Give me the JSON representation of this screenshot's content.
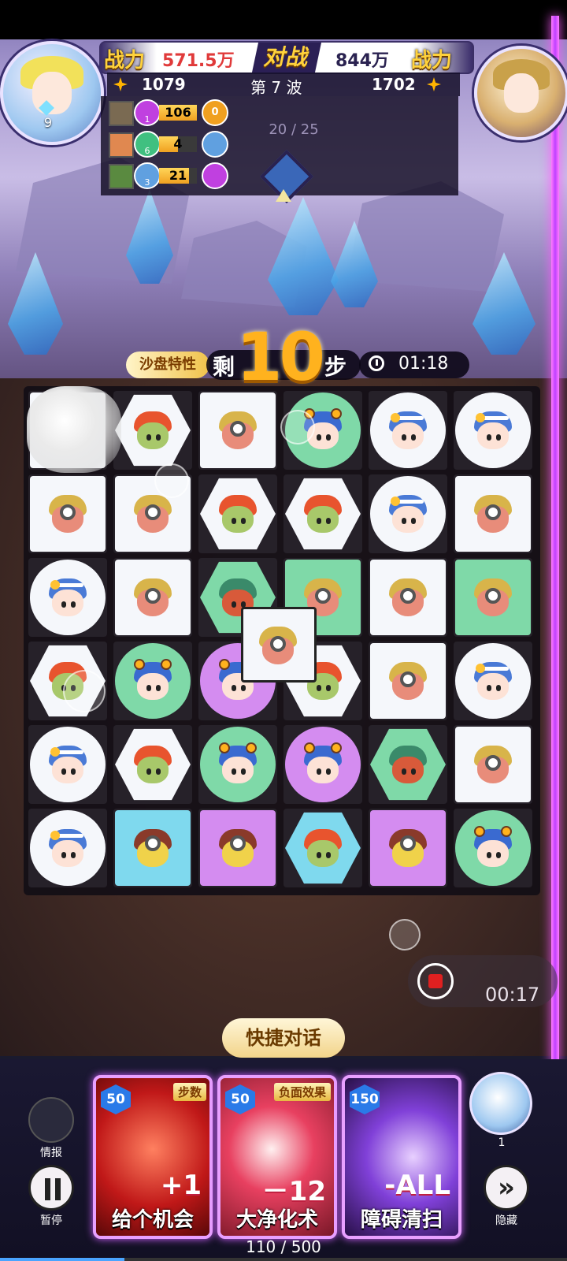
{
  "hud": {
    "player_power_label": "战力",
    "player_power": "571.5万",
    "vs_label": "对战",
    "enemy_power": "844万",
    "enemy_power_label": "战力",
    "player_score": "1079",
    "wave": "第 7 波",
    "enemy_score": "1702",
    "player_level": "9",
    "wave_progress": "20 / 25"
  },
  "team_targets": [
    {
      "gem_label": "1",
      "gem_color": "#c040e0",
      "count": "106",
      "fill": 1.0,
      "target": "0",
      "target_color": "#f0a020"
    },
    {
      "gem_label": "6",
      "gem_color": "#40c080",
      "count": "4",
      "fill": 0.5,
      "target": "",
      "target_color": "#60a0e0"
    },
    {
      "gem_label": "3",
      "gem_color": "#60a0e0",
      "count": "21",
      "fill": 0.8,
      "target": "",
      "target_color": "#c040e0"
    }
  ],
  "steps": {
    "tag": "沙盘特性",
    "prefix": "剩",
    "value": "10",
    "suffix": "步",
    "timer": "01:18"
  },
  "board": {
    "rows": 6,
    "cols": 6,
    "tiles": [
      [
        "smoke-minion",
        "goblin-hex",
        "minion-square",
        "boy-circle-green",
        "girl-circle",
        "girl-circle"
      ],
      [
        "minion-square",
        "minion-square",
        "goblin-hex",
        "goblin-hex",
        "girl-circle",
        "minion-square"
      ],
      [
        "girl-circle",
        "minion-square",
        "orc-hex-green",
        "minion-square-green",
        "minion-square",
        "minion-square-green"
      ],
      [
        "goblin-hex",
        "boy-circle-green",
        "boy-circle-purple",
        "goblin-hex",
        "minion-square",
        "girl-circle"
      ],
      [
        "girl-circle",
        "goblin-hex",
        "boy-circle-green",
        "boy-circle-purple",
        "orc-hex-green",
        "minion-square"
      ],
      [
        "girl-circle",
        "brute-square-cyan",
        "brute-square-purple",
        "goblin-hex-cyan",
        "brute-square-purple",
        "boy-circle-green"
      ]
    ]
  },
  "recording": {
    "time": "00:17"
  },
  "quick_chat_label": "快捷对话",
  "side_left": {
    "info_label": "情报",
    "pause_label": "暂停"
  },
  "side_right": {
    "hide_label": "隐藏",
    "helper_level": "1"
  },
  "cards": [
    {
      "cost": "50",
      "tag": "步数",
      "effect": "+1",
      "name": "给个机会",
      "color": "#c02020"
    },
    {
      "cost": "50",
      "tag": "负面效果",
      "effect": "－12",
      "name": "大净化术",
      "color": "#c03040"
    },
    {
      "cost": "150",
      "tag": "",
      "effect": "-ALL",
      "name": "障碍清扫",
      "color": "#6030a0"
    }
  ],
  "energy": {
    "text": "110 / 500",
    "fraction": 0.22
  }
}
